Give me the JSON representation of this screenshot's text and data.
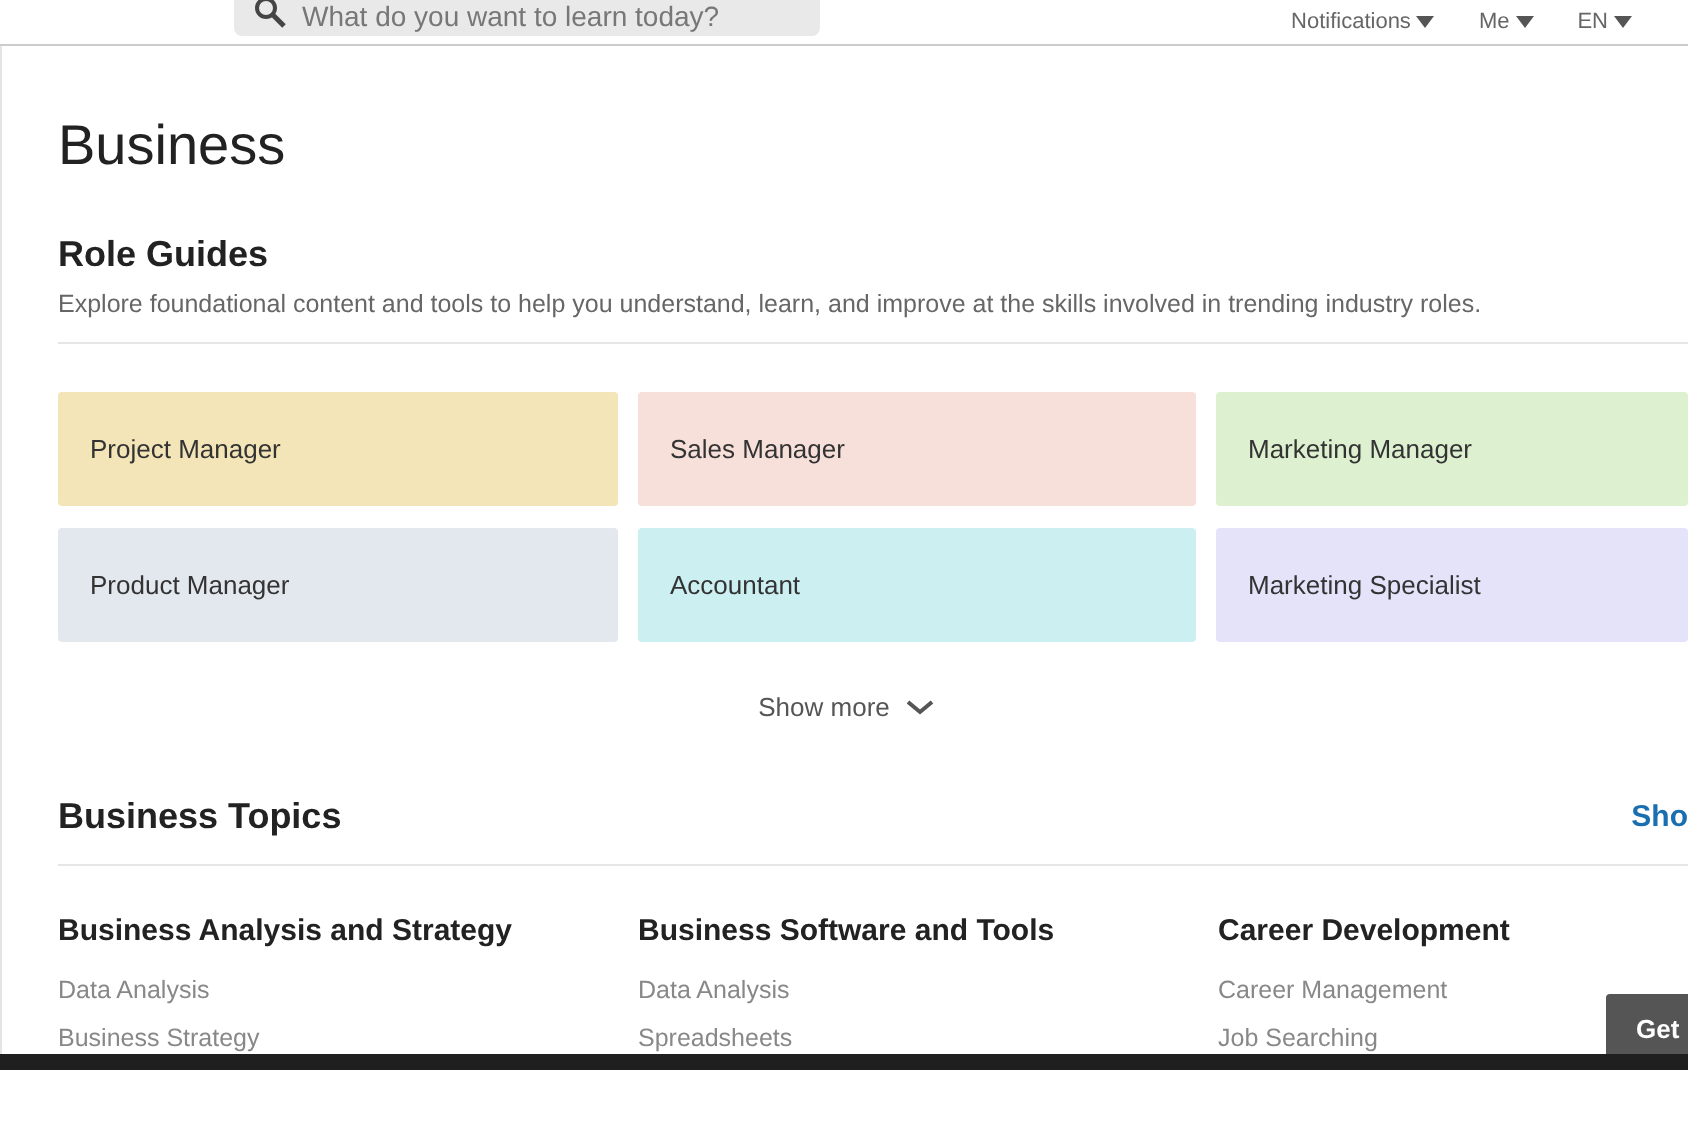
{
  "header": {
    "search": {
      "placeholder": "What do you want to learn today?"
    },
    "menus": [
      {
        "label": "Notifications"
      },
      {
        "label": "Me"
      },
      {
        "label": "EN"
      }
    ]
  },
  "page_title": "Business",
  "role_guides": {
    "title": "Role Guides",
    "description": "Explore foundational content and tools to help you understand, learn, and improve at the skills involved in trending industry roles.",
    "cards": [
      {
        "label": "Project Manager",
        "color": "#f3e5b7"
      },
      {
        "label": "Sales Manager",
        "color": "#f7e0da"
      },
      {
        "label": "Marketing Manager",
        "color": "#ddf0d0"
      },
      {
        "label": "Product Manager",
        "color": "#e2e8ee"
      },
      {
        "label": "Accountant",
        "color": "#ccf0f2"
      },
      {
        "label": "Marketing Specialist",
        "color": "#e5e3fa"
      }
    ],
    "show_more": "Show more"
  },
  "topics": {
    "title": "Business Topics",
    "show_all": "Sho",
    "columns": [
      {
        "heading": "Business Analysis and Strategy",
        "links": [
          "Data Analysis",
          "Business Strategy"
        ]
      },
      {
        "heading": "Business Software and Tools",
        "links": [
          "Data Analysis",
          "Spreadsheets"
        ]
      },
      {
        "heading": "Career Development",
        "links": [
          "Career Management",
          "Job Searching"
        ]
      }
    ]
  },
  "floating_button": "Get"
}
